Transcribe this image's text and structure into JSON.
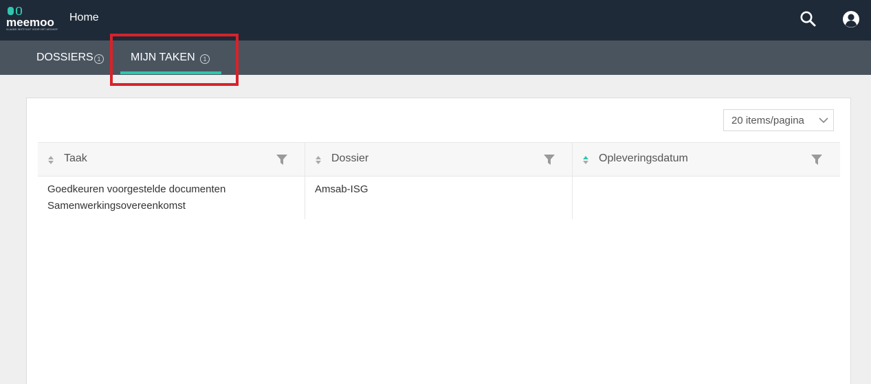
{
  "colors": {
    "topbar": "#1e2a38",
    "tabsbar": "#4a545f",
    "accent": "#2fc6ae",
    "highlight": "#d9222a"
  },
  "logo": {
    "word": "meemoo",
    "subtitle": "VLAAMS INSTITUUT VOOR HET ARCHIEF"
  },
  "header": {
    "home_label": "Home",
    "search_icon": "search-icon",
    "avatar_icon": "user-avatar-icon"
  },
  "tabs": [
    {
      "label": "DOSSIERS",
      "count": "1",
      "active": false
    },
    {
      "label": "MIJN TAKEN",
      "count": "1",
      "active": true
    }
  ],
  "pagination": {
    "per_page": "20 items/pagina"
  },
  "table": {
    "columns": [
      {
        "label": "Taak",
        "sort_active": false
      },
      {
        "label": "Dossier",
        "sort_active": false
      },
      {
        "label": "Opleveringsdatum",
        "sort_active": true
      }
    ],
    "rows": [
      {
        "taak_line1": "Goedkeuren voorgestelde documenten",
        "taak_line2": "Samenwerkingsovereenkomst",
        "dossier": "Amsab-ISG",
        "opleveringsdatum": ""
      }
    ]
  }
}
